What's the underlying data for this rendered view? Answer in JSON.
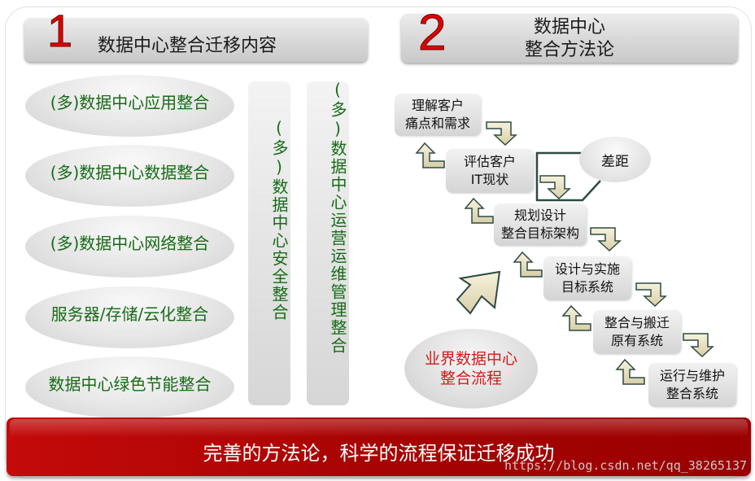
{
  "section1": {
    "number": "1",
    "title": "数据中心整合迁移内容",
    "items": [
      "(多)数据中心应用整合",
      "(多)数据中心数据整合",
      "(多)数据中心网络整合",
      "服务器/存储/云化整合",
      "数据中心绿色节能整合"
    ],
    "vertical_items": [
      "(多)数据中心安全整合",
      "(多)数据中心运营运维管理整合"
    ]
  },
  "section2": {
    "number": "2",
    "title_line1": "数据中心",
    "title_line2": "整合方法论",
    "steps": [
      {
        "line1": "理解客户",
        "line2": "痛点和需求"
      },
      {
        "line1": "评估客户",
        "line2": "IT现状"
      },
      {
        "line1": "规划设计",
        "line2": "整合目标架构"
      },
      {
        "line1": "设计与实施",
        "line2": "目标系统"
      },
      {
        "line1": "整合与搬迁",
        "line2": "原有系统"
      },
      {
        "line1": "运行与维护",
        "line2": "整合系统"
      }
    ],
    "gap_label": "差距",
    "flow_label_line1": "业界数据中心",
    "flow_label_line2": "整合流程"
  },
  "footer": {
    "slogan": "完善的方法论，科学的流程保证迁移成功",
    "watermark": "https://blog.csdn.net/qq_38265137"
  },
  "colors": {
    "accent_red": "#e00000",
    "item_green": "#176b17",
    "flow_red": "#d41a1a",
    "banner_red": "#a70303"
  }
}
